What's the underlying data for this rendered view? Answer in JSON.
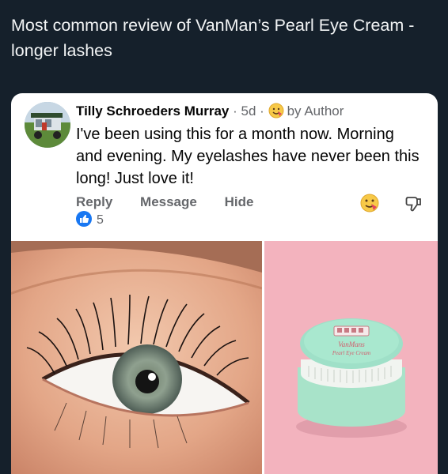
{
  "post": {
    "text": "Most common review of VanMan’s Pearl Eye Cream - longer lashes"
  },
  "comment": {
    "author": "Tilly Schroeders Murray",
    "time": "5d",
    "separator": "·",
    "badge_label": "by Author",
    "body": "I've been using this for a month now. Morning and evening. My eyelashes have never been this long! Just love it!",
    "actions": {
      "reply": "Reply",
      "message": "Message",
      "hide": "Hide"
    },
    "like_count": "5"
  },
  "jar": {
    "brand": "VanMans",
    "product": "Pearl Eye Cream"
  },
  "colors": {
    "background": "#15202b",
    "card": "#ffffff",
    "like_blue": "#1877f2",
    "jar_mint": "#9fe0c8",
    "pink_backdrop": "#f3b3be"
  },
  "icons": [
    "author-badge-icon",
    "reaction-icon",
    "dislike-icon",
    "like-icon"
  ]
}
